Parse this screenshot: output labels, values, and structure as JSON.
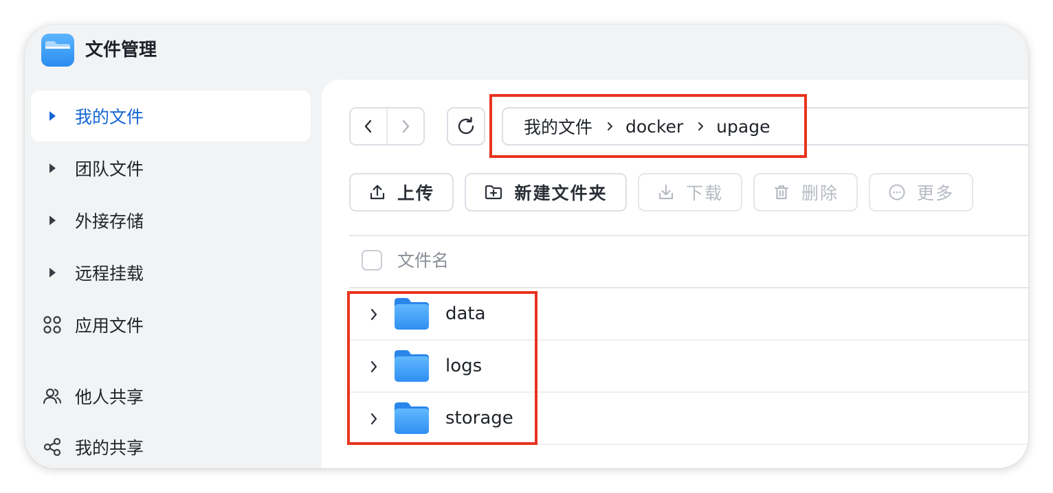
{
  "app": {
    "title": "文件管理",
    "icon": "folder-app-icon"
  },
  "sidebar": {
    "items": [
      {
        "label": "我的文件",
        "icon": "caret-right-icon",
        "active": true
      },
      {
        "label": "团队文件",
        "icon": "caret-right-icon",
        "active": false
      },
      {
        "label": "外接存储",
        "icon": "caret-right-icon",
        "active": false
      },
      {
        "label": "远程挂载",
        "icon": "caret-right-icon",
        "active": false
      },
      {
        "label": "应用文件",
        "icon": "apps-grid-icon",
        "active": false
      },
      {
        "label": "他人共享",
        "icon": "users-icon",
        "active": false
      },
      {
        "label": "我的共享",
        "icon": "share-icon",
        "active": false
      }
    ]
  },
  "breadcrumb": [
    "我的文件",
    "docker",
    "upage"
  ],
  "toolbar": {
    "upload": "上传",
    "new_folder": "新建文件夹",
    "download": "下载",
    "delete": "删除",
    "more": "更多"
  },
  "list": {
    "column_name": "文件名",
    "rows": [
      {
        "name": "data"
      },
      {
        "name": "logs"
      },
      {
        "name": "storage"
      }
    ]
  },
  "colors": {
    "accent": "#1466d4",
    "highlight": "#e8331f",
    "folder": "#3d9df5"
  }
}
